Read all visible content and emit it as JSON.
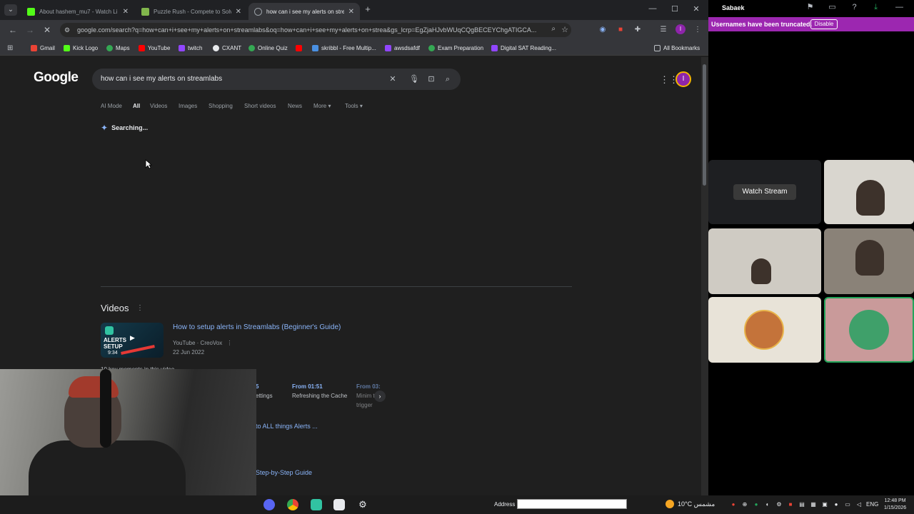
{
  "browser": {
    "tabs": [
      {
        "title": "About hashem_mu7 - Watch Li",
        "color": "#53fc18",
        "active": false
      },
      {
        "title": "Puzzle Rush - Compete to Solv",
        "color": "#81b64c",
        "active": false
      },
      {
        "title": "how can i see my alerts on stre",
        "color": "#9aa0a6",
        "active": true
      }
    ],
    "url": "google.com/search?q=how+can+i+see+my+alerts+on+streamlabs&oq=how+can+i+see+my+alerts+on+strea&gs_lcrp=EgZjaHJvbWUqCQgBECEYChgATIGCA...",
    "bookmarks": [
      {
        "label": "Gmail",
        "color": "#ea4335"
      },
      {
        "label": "Kick Logo",
        "color": "#53fc18"
      },
      {
        "label": "Maps",
        "color": "#34a853"
      },
      {
        "label": "YouTube",
        "color": "#ff0000"
      },
      {
        "label": "twitch",
        "color": "#9146ff"
      },
      {
        "label": "CXANT",
        "color": "#e8eaed"
      },
      {
        "label": "Online Quiz",
        "color": "#34a853"
      },
      {
        "label": "",
        "color": "#ff0000"
      },
      {
        "label": "skribbl - Free Multip...",
        "color": "#4a90e2"
      },
      {
        "label": "awsdsafdf",
        "color": "#9146ff"
      },
      {
        "label": "Exam Preparation",
        "color": "#34a853"
      },
      {
        "label": "Digital SAT Reading...",
        "color": "#9146ff"
      }
    ],
    "all_bookmarks": "All Bookmarks",
    "profile_initial": "I"
  },
  "google": {
    "logo": "Google",
    "query": "how can i see my alerts on streamlabs",
    "tabs": [
      "AI Mode",
      "All",
      "Videos",
      "Images",
      "Shopping",
      "Short videos",
      "News",
      "More ▾",
      "Tools ▾"
    ],
    "searching": "Searching...",
    "videos_heading": "Videos",
    "video": {
      "title": "How to setup alerts in Streamlabs (Beginner's Guide)",
      "source": "YouTube · CreoVox",
      "date": "22 Jun 2022",
      "thumb_text": "ALERTS SETUP",
      "duration": "9:34"
    },
    "key_moments": "10 key moments in this video",
    "moments": [
      {
        "time": "5",
        "desc": "ettings"
      },
      {
        "time": "From 01:51",
        "desc": "Refreshing the Cache"
      },
      {
        "time": "From 03:",
        "desc": "Minim to trigger"
      }
    ],
    "link_1": "to ALL things Alerts ...",
    "link_2": "Step-by-Step Guide"
  },
  "taskbar": {
    "address_label": "Address",
    "weather": "10°C  مشمس",
    "lang": "ENG",
    "time": "12:48 PM",
    "date": "1/15/2026"
  },
  "call": {
    "server_name": "Sabaek",
    "banner_msg": "Usernames have been truncated.",
    "banner_btn": "Disable",
    "watch_stream": "Watch Stream"
  }
}
